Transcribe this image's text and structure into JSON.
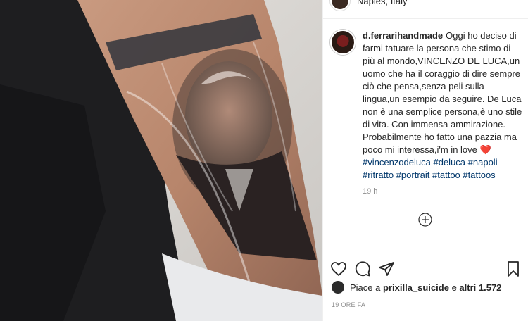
{
  "post": {
    "location": "Naples, Italy",
    "username": "d.ferrarihandmade",
    "caption": "Oggi ho deciso di farmi tatuare la persona che stimo di più al mondo,VINCENZO DE LUCA,un uomo che ha il coraggio di dire sempre ciò che pensa,senza peli sulla lingua,un esempio da seguire. De Luca non è una semplice persona,è uno stile di vita. Con immensa ammirazione. Probabilmente ho fatto una pazzia ma poco mi interessa,i'm in love",
    "heart_emoji": "❤️",
    "hashtags": [
      "#vincenzodeluca",
      "#deluca",
      "#napoli",
      "#ritratto",
      "#portrait",
      "#tattoo",
      "#tattoos"
    ],
    "caption_age": "19 h",
    "likes_prefix": "Piace a",
    "liked_by": "prixilla_suicide",
    "likes_joiner": "e",
    "likes_others": "altri 1.572",
    "post_date": "19 ORE FA"
  },
  "icons": {
    "load_more": "plus-circle-icon",
    "like": "heart-icon",
    "comment": "comment-bubble-icon",
    "share": "paper-plane-icon",
    "save": "bookmark-icon"
  },
  "colors": {
    "link": "#00376b",
    "secondary_text": "#8e8e8e",
    "heart": "#e0245e",
    "text": "#262626"
  }
}
